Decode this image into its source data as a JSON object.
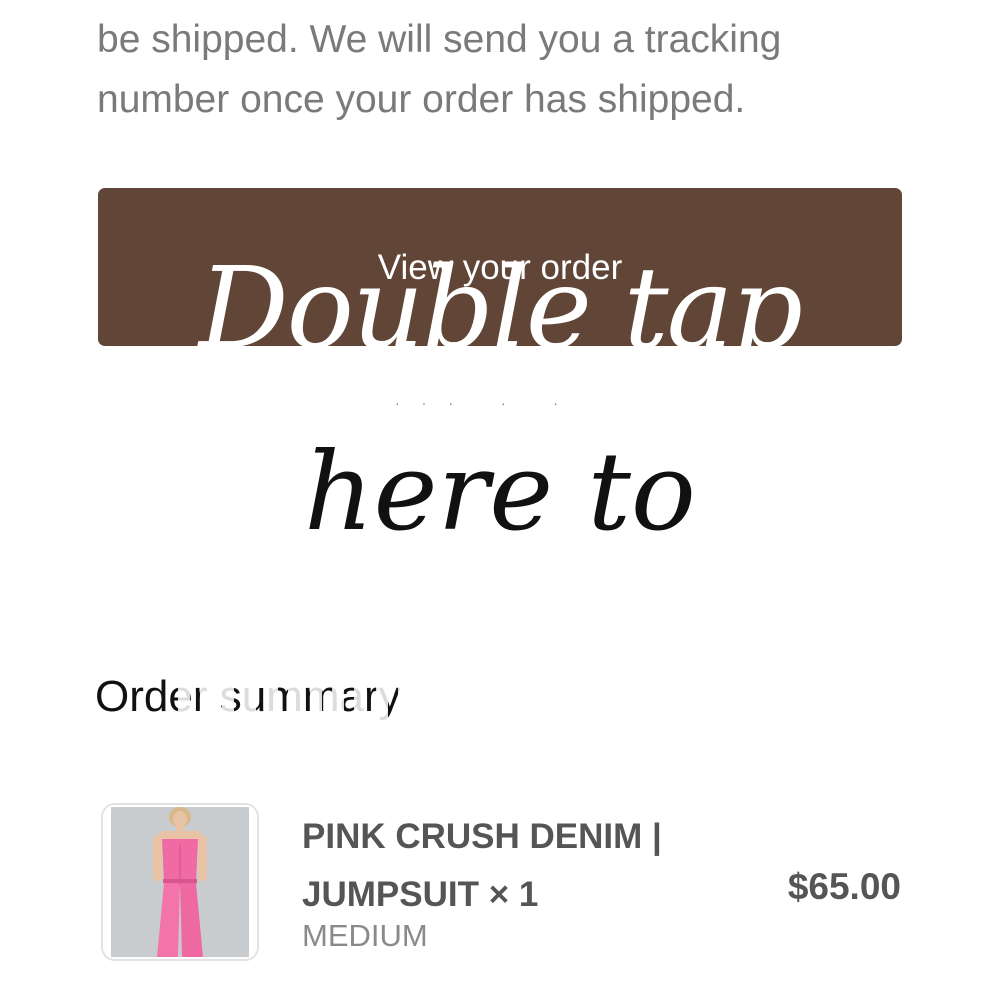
{
  "email": {
    "shipping_message": "be shipped. We will send you a tracking number once your order has shipped.",
    "button": {
      "label": "View your order",
      "color": "#614536"
    },
    "overlay": {
      "line1": "Double tap",
      "line2": "here to"
    },
    "order_summary": {
      "title": "Order summary",
      "items": [
        {
          "name": "PINK CRUSH DENIM | JUMPSUIT",
          "quantity": "× 1",
          "variant": "MEDIUM",
          "price": "$65.00",
          "image": "pink-jumpsuit-photo"
        }
      ]
    }
  }
}
